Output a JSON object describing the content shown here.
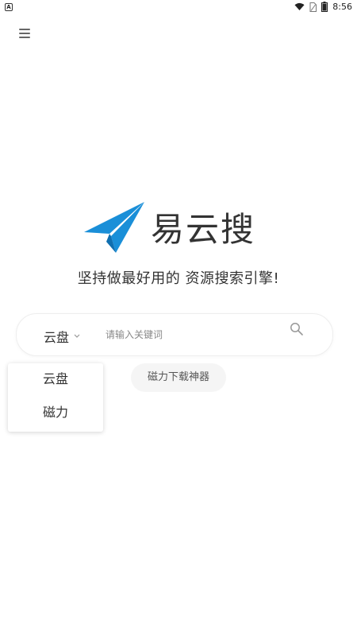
{
  "status_bar": {
    "app_icon_letter": "A",
    "time": "8:56",
    "icons": [
      "wifi-icon",
      "sim-icon",
      "battery-icon"
    ]
  },
  "header": {
    "menu_icon": "hamburger-menu-icon"
  },
  "logo": {
    "text": "易云搜",
    "brand_color": "#1a8fd8"
  },
  "slogan": "坚持做最好用的 资源搜索引擎!",
  "search": {
    "selected_type": "云盘",
    "placeholder": "请输入关键词",
    "value": ""
  },
  "dropdown": {
    "options": [
      "云盘",
      "磁力"
    ]
  },
  "chip": {
    "label": "磁力下载神器"
  }
}
